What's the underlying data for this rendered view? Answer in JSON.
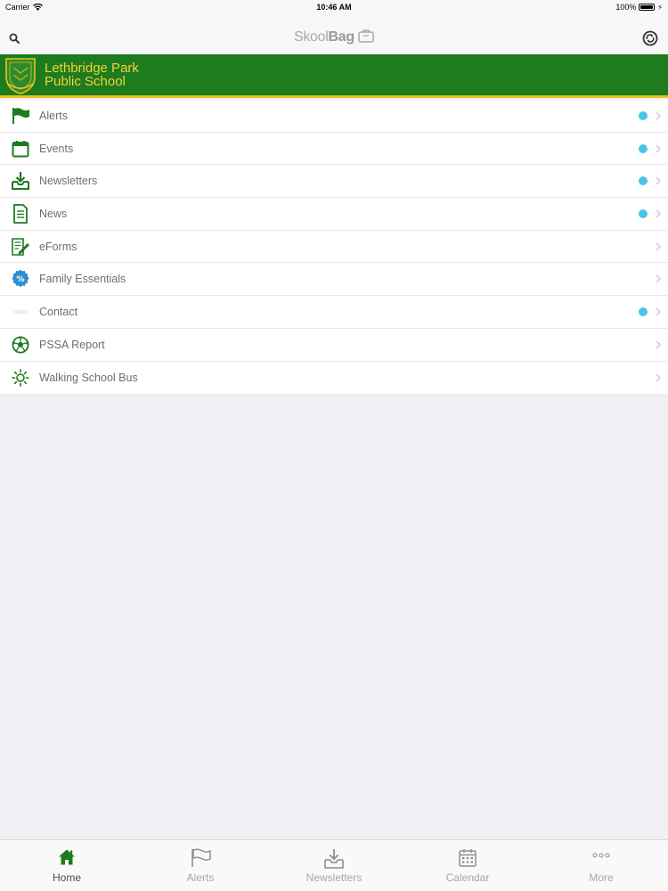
{
  "status": {
    "carrier": "Carrier",
    "time": "10:46 AM",
    "battery": "100%"
  },
  "nav": {
    "brand_light": "Skool",
    "brand_bold": "Bag"
  },
  "school": {
    "line1": "Lethbridge Park",
    "line2": "Public School"
  },
  "colors": {
    "brand_green": "#1e7b1e",
    "accent_yellow": "#e9c21f",
    "badge_blue": "#4cc3ec"
  },
  "menu": {
    "items": [
      {
        "label": "Alerts",
        "icon": "flag-icon",
        "badge": true
      },
      {
        "label": "Events",
        "icon": "calendar-icon",
        "badge": true
      },
      {
        "label": "Newsletters",
        "icon": "inbox-download-icon",
        "badge": true
      },
      {
        "label": "News",
        "icon": "document-icon",
        "badge": true
      },
      {
        "label": "eForms",
        "icon": "form-pencil-icon",
        "badge": false
      },
      {
        "label": "Family Essentials",
        "icon": "percent-badge-icon",
        "badge": false
      },
      {
        "label": "Contact",
        "icon": "contact-icon",
        "badge": true
      },
      {
        "label": "PSSA Report",
        "icon": "soccer-ball-icon",
        "badge": false
      },
      {
        "label": "Walking School Bus",
        "icon": "sun-icon",
        "badge": false
      }
    ]
  },
  "tabs": [
    {
      "label": "Home",
      "icon": "home-icon",
      "active": true
    },
    {
      "label": "Alerts",
      "icon": "flag-icon",
      "active": false
    },
    {
      "label": "Newsletters",
      "icon": "inbox-download-icon",
      "active": false
    },
    {
      "label": "Calendar",
      "icon": "calendar-icon",
      "active": false
    },
    {
      "label": "More",
      "icon": "more-dots-icon",
      "active": false
    }
  ]
}
